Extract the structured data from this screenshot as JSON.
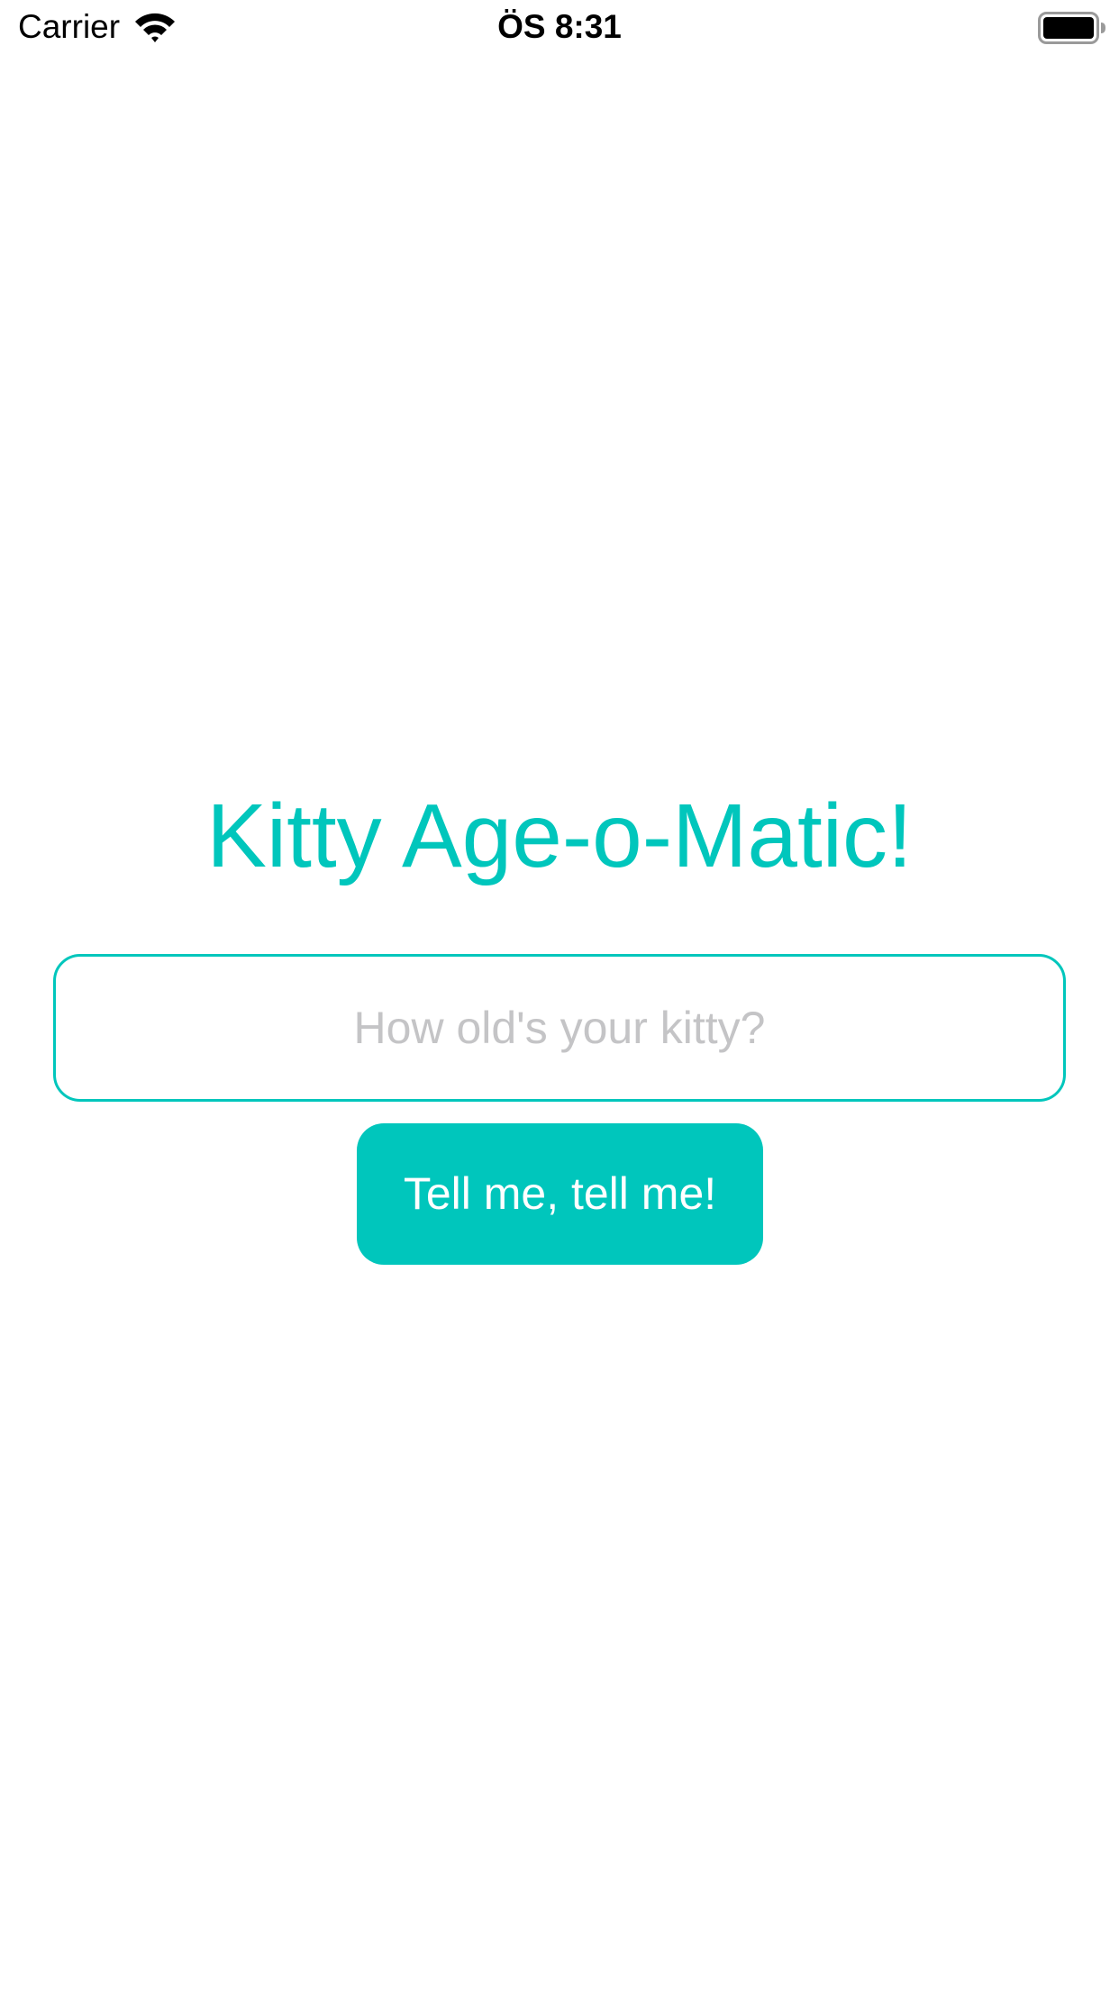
{
  "status_bar": {
    "carrier": "Carrier",
    "time": "ÖS 8:31",
    "wifi_icon": "wifi-icon",
    "battery_icon": "battery-icon"
  },
  "main": {
    "title": "Kitty Age-o-Matic!",
    "age_input": {
      "value": "",
      "placeholder": "How old's your kitty?"
    },
    "submit_label": "Tell me, tell me!"
  },
  "colors": {
    "accent": "#00c6bc",
    "placeholder": "#c4c4c6",
    "background": "#ffffff"
  }
}
